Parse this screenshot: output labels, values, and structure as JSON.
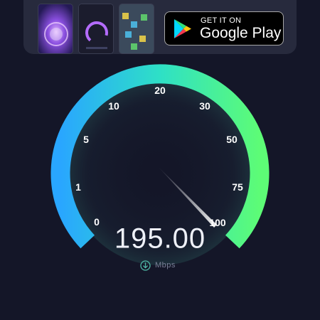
{
  "promo": {
    "badge_small": "GET IT ON",
    "badge_large": "Google Play",
    "logo_icon": "google-play-icon"
  },
  "gauge": {
    "ticks": [
      "0",
      "1",
      "5",
      "10",
      "20",
      "30",
      "50",
      "75",
      "100"
    ],
    "needle_value": 100,
    "speed_value": "195.00",
    "unit": "Mbps",
    "unit_icon": "download-arrow-icon",
    "colors": {
      "arc_start": "#29a6ff",
      "arc_mid": "#2ee0c6",
      "arc_end": "#5dfc76",
      "background": "#141628"
    }
  }
}
